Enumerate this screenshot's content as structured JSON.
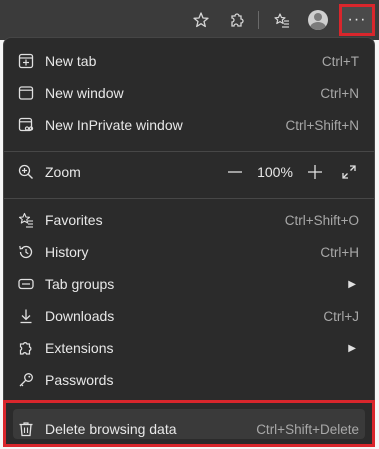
{
  "toolbar": {
    "favorites_icon": "star-outline-icon",
    "extensions_icon": "puzzle-icon",
    "collections_icon": "star-list-icon",
    "profile_icon": "avatar-icon",
    "more_label": "···"
  },
  "menu": {
    "new_tab": {
      "label": "New tab",
      "shortcut": "Ctrl+T",
      "icon": "new-tab-icon"
    },
    "new_window": {
      "label": "New window",
      "shortcut": "Ctrl+N",
      "icon": "window-icon"
    },
    "new_inprivate": {
      "label": "New InPrivate window",
      "shortcut": "Ctrl+Shift+N",
      "icon": "inprivate-icon"
    },
    "zoom": {
      "label": "Zoom",
      "value": "100%",
      "minus": "—",
      "plus": "+",
      "icon": "zoom-icon"
    },
    "favorites": {
      "label": "Favorites",
      "shortcut": "Ctrl+Shift+O",
      "icon": "favorites-icon"
    },
    "history": {
      "label": "History",
      "shortcut": "Ctrl+H",
      "icon": "history-icon"
    },
    "tab_groups": {
      "label": "Tab groups",
      "icon": "tab-groups-icon"
    },
    "downloads": {
      "label": "Downloads",
      "shortcut": "Ctrl+J",
      "icon": "download-icon"
    },
    "extensions": {
      "label": "Extensions",
      "icon": "puzzle-icon"
    },
    "passwords": {
      "label": "Passwords",
      "icon": "key-icon"
    },
    "delete_browsing_data": {
      "label": "Delete browsing data",
      "shortcut": "Ctrl+Shift+Delete",
      "icon": "trash-icon"
    }
  },
  "colors": {
    "menu_bg": "#2b2b2b",
    "toolbar_bg": "#3b3b3b",
    "highlight_border": "#d9262c",
    "text": "#e8e8e8",
    "shortcut_text": "#a8a8a8"
  }
}
